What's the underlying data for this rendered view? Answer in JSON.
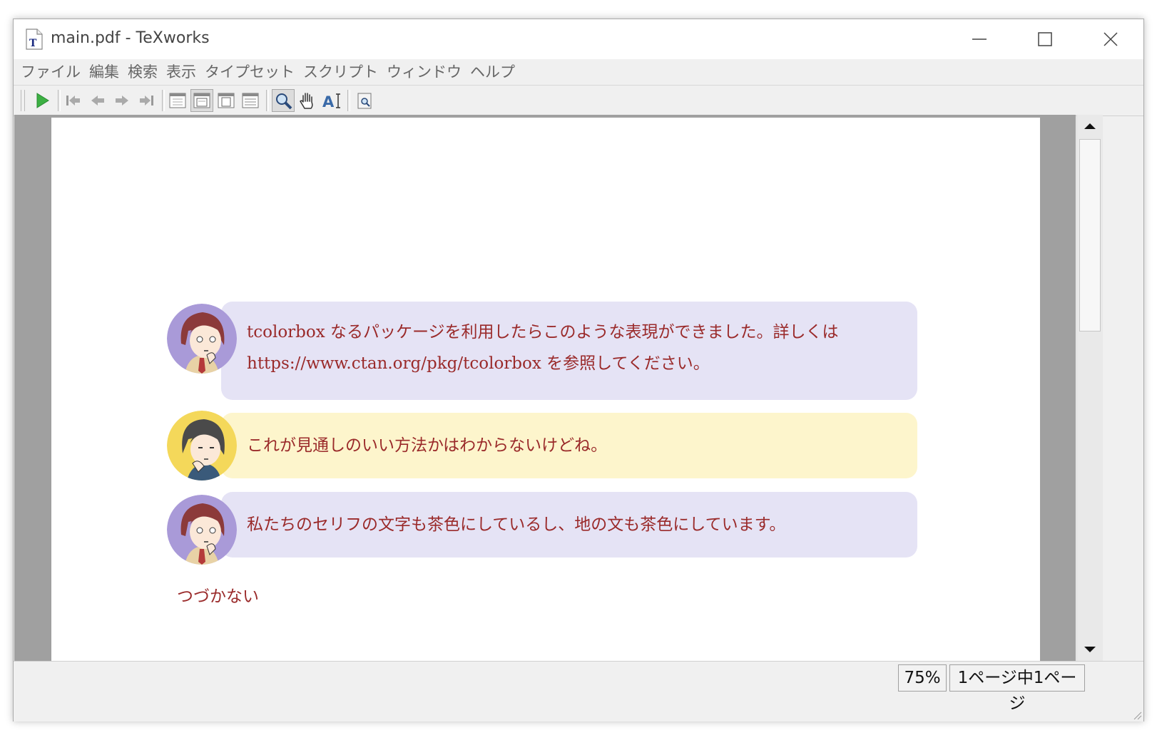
{
  "window": {
    "title": "main.pdf - TeXworks",
    "app_icon": "tex-document-icon"
  },
  "menubar": {
    "items": [
      {
        "label": "ファイル"
      },
      {
        "label": "編集"
      },
      {
        "label": "検索"
      },
      {
        "label": "表示"
      },
      {
        "label": "タイプセット"
      },
      {
        "label": "スクリプト"
      },
      {
        "label": "ウィンドウ"
      },
      {
        "label": "ヘルプ"
      }
    ]
  },
  "toolbar": {
    "icons": [
      "typeset-play-icon",
      "first-page-icon",
      "previous-page-icon",
      "next-page-icon",
      "last-page-icon",
      "actual-size-icon",
      "fit-width-icon",
      "fit-page-icon",
      "fit-content-icon",
      "magnify-icon",
      "hand-tool-icon",
      "select-text-icon",
      "find-icon"
    ],
    "active": [
      "fit-width-icon",
      "magnify-icon"
    ],
    "play_color": "#3cb043"
  },
  "document": {
    "messages": [
      {
        "text": "tcolorbox なるパッケージを利用したらこのような表現ができました。詳しくは https://www.ctan.org/pkg/tcolorbox を参照してください。",
        "avatar": "red-haired-girl-avatar",
        "bubble_color": "#e5e3f5"
      },
      {
        "text": "これが見通しのいい方法かはわからないけどね。",
        "avatar": "dark-haired-boy-avatar",
        "bubble_color": "#fdf5cc"
      },
      {
        "text": "私たちのセリフの文字も茶色にしているし、地の文も茶色にしています。",
        "avatar": "red-haired-girl-avatar",
        "bubble_color": "#e5e3f5"
      }
    ],
    "message1_line1": "tcolorbox なるパッケージを利用したらこのような表現ができました。詳しくは",
    "message1_line2": "https://www.ctan.org/pkg/tcolorbox を参照してください。",
    "footer": "つづかない",
    "text_color": "#9a2a2a"
  },
  "status": {
    "zoom": "75%",
    "page": "1ページ中1ページ"
  }
}
